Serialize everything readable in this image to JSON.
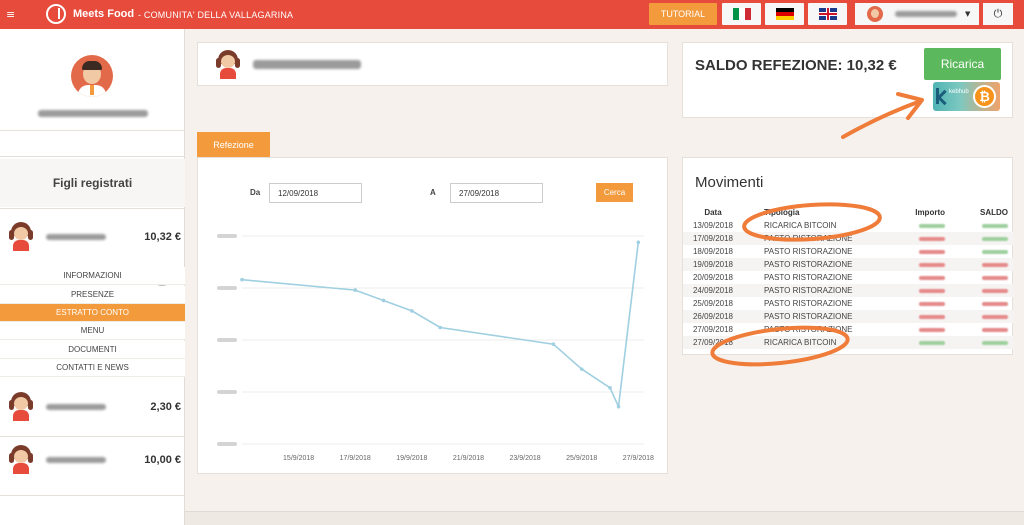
{
  "app": {
    "brand": "Meets Food",
    "subtitle": "- COMUNITA' DELLA VALLAGARINA",
    "tutorial_label": "TUTORIAL"
  },
  "sidebar": {
    "section_title": "Figli registrati",
    "children": [
      {
        "balance": "10,32 €"
      },
      {
        "balance": "2,30 €"
      },
      {
        "balance": "10,00 €"
      }
    ],
    "menu": [
      {
        "label": "INFORMAZIONI",
        "active": false
      },
      {
        "label": "PRESENZE",
        "active": false
      },
      {
        "label": "ESTRATTO CONTO",
        "active": true
      },
      {
        "label": "MENU",
        "active": false
      },
      {
        "label": "DOCUMENTI",
        "active": false
      },
      {
        "label": "CONTATTI E NEWS",
        "active": false
      }
    ]
  },
  "main": {
    "tab_label": "Refezione",
    "filter": {
      "from_label": "Da",
      "from_value": "12/09/2018",
      "to_label": "A",
      "to_value": "27/09/2018",
      "search_label": "Cerca"
    }
  },
  "balance": {
    "title": "SALDO REFEZIONE: 10,32 €",
    "recharge_label": "Ricarica",
    "badge_text": "kebhub",
    "coin_symbol": "₿"
  },
  "movements": {
    "title": "Movimenti",
    "headers": {
      "data": "Data",
      "tipologia": "Tipologia",
      "importo": "Importo",
      "saldo": "SALDO"
    },
    "rows": [
      {
        "data": "13/09/2018",
        "tipologia": "RICARICA BITCOIN",
        "importo_kind": "green",
        "saldo_kind": "green"
      },
      {
        "data": "17/09/2018",
        "tipologia": "PASTO RISTORAZIONE",
        "importo_kind": "red",
        "saldo_kind": "green"
      },
      {
        "data": "18/09/2018",
        "tipologia": "PASTO RISTORAZIONE",
        "importo_kind": "red",
        "saldo_kind": "green"
      },
      {
        "data": "19/09/2018",
        "tipologia": "PASTO RISTORAZIONE",
        "importo_kind": "red",
        "saldo_kind": "red"
      },
      {
        "data": "20/09/2018",
        "tipologia": "PASTO RISTORAZIONE",
        "importo_kind": "red",
        "saldo_kind": "red"
      },
      {
        "data": "24/09/2018",
        "tipologia": "PASTO RISTORAZIONE",
        "importo_kind": "red",
        "saldo_kind": "red"
      },
      {
        "data": "25/09/2018",
        "tipologia": "PASTO RISTORAZIONE",
        "importo_kind": "red",
        "saldo_kind": "red"
      },
      {
        "data": "26/09/2018",
        "tipologia": "PASTO RISTORAZIONE",
        "importo_kind": "red",
        "saldo_kind": "red"
      },
      {
        "data": "27/09/2018",
        "tipologia": "PASTO RISTORAZIONE",
        "importo_kind": "red",
        "saldo_kind": "red"
      },
      {
        "data": "27/09/2018",
        "tipologia": "RICARICA BITCOIN",
        "importo_kind": "green",
        "saldo_kind": "green"
      }
    ]
  },
  "colors": {
    "topbar": "#e74b3c",
    "accent_orange": "#f39a3d",
    "recharge_green": "#5cb85c",
    "chart_line": "#9fcfe0",
    "annotation": "#f07c3a"
  },
  "icons": {
    "menu": "hamburger-icon",
    "logo": "hand-logo-icon",
    "power": "power-icon",
    "collapse": "chevron-up-icon",
    "badge": "bitcoin-icon"
  },
  "chart_data": {
    "type": "line",
    "x_tick_labels": [
      "15/9/2018",
      "17/9/2018",
      "19/9/2018",
      "21/9/2018",
      "23/9/2018",
      "25/9/2018",
      "27/9/2018"
    ],
    "x": [
      13,
      17,
      18,
      19,
      20,
      24,
      25,
      26,
      26.3,
      27
    ],
    "y": [
      0.79,
      0.74,
      0.69,
      0.64,
      0.56,
      0.48,
      0.36,
      0.27,
      0.18,
      0.97
    ],
    "y_axis_range": [
      0,
      1
    ],
    "y_tick_labels_obscured": true,
    "grid": true,
    "legend": "none"
  }
}
